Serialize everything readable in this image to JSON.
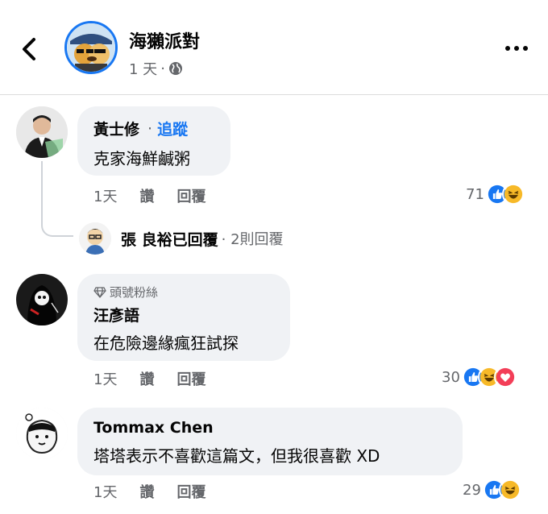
{
  "header": {
    "page_name": "海獺派對",
    "time": "1 天",
    "separator": "·",
    "icons": {
      "back": "chevron-left-icon",
      "globe": "globe-icon",
      "more": "more-dots-icon"
    }
  },
  "comments": [
    {
      "author": "黃士修",
      "separator": "·",
      "follow_label": "追蹤",
      "text": "克家海鮮鹹粥",
      "time": "1天",
      "like_label": "讚",
      "reply_label": "回覆",
      "reaction_count": "71",
      "reactions": [
        "like",
        "haha"
      ]
    },
    {
      "badge": "頭號粉絲",
      "author": "汪彥語",
      "text": "在危險邊緣瘋狂試探",
      "time": "1天",
      "like_label": "讚",
      "reply_label": "回覆",
      "reaction_count": "30",
      "reactions": [
        "like",
        "haha",
        "love"
      ]
    },
    {
      "author": "Tommax Chen",
      "text": "塔塔表示不喜歡這篇文，但我很喜歡 XD",
      "time": "1天",
      "like_label": "讚",
      "reply_label": "回覆",
      "reaction_count": "29",
      "reactions": [
        "like",
        "haha"
      ]
    }
  ],
  "reply_preview": {
    "name": "張 良裕已回覆",
    "count": "· 2則回覆"
  },
  "colors": {
    "accent": "#1877f2",
    "like": "#1877f2",
    "haha": "#f7b928",
    "love": "#f33e58",
    "bubble": "#f0f2f5",
    "muted": "#65676b"
  }
}
